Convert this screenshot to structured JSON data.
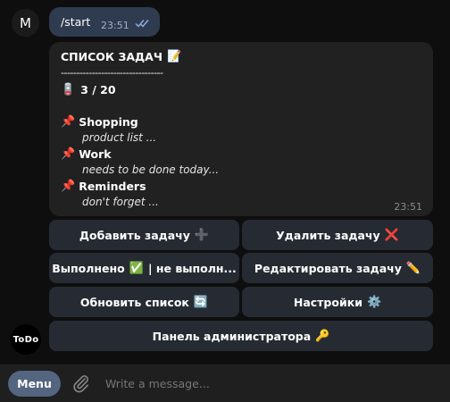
{
  "user_message": {
    "avatar_letter": "M",
    "text": "/start",
    "time": "23:51"
  },
  "bot_message": {
    "title": "СПИСОК ЗАДАЧ",
    "divider": "---------------------------------",
    "counter": "3 / 20",
    "tasks": [
      {
        "name": "Shopping",
        "desc": "product list ..."
      },
      {
        "name": "Work",
        "desc": "needs to be done today..."
      },
      {
        "name": "Reminders",
        "desc": "don't forget ..."
      }
    ],
    "time": "23:51"
  },
  "keyboard": {
    "add": "Добавить задачу",
    "delete": "Удалить задачу",
    "done_toggle": "Выполнено",
    "done_toggle_rest": "| не выполн...",
    "edit": "Редактировать задачу",
    "refresh": "Обновить список",
    "settings": "Настройки",
    "admin": "Панель администратора"
  },
  "bot_avatar_text": "ToDo",
  "composer": {
    "menu_label": "Menu",
    "placeholder": "Write a message..."
  },
  "colors": {
    "accent": "#53657f",
    "bubble_out": "#2f3b4f",
    "bubble_in": "#212121",
    "button": "#262b33"
  }
}
